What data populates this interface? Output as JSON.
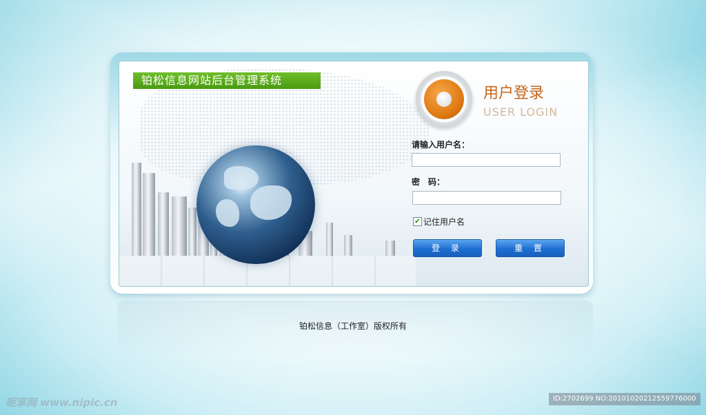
{
  "header": {
    "system_title": "铂松信息网站后台管理系统"
  },
  "login": {
    "title_cn": "用户登录",
    "title_en": "USER LOGIN",
    "username_label": "请输入用户名：",
    "username_value": "",
    "password_label": "密　码：",
    "password_value": "",
    "remember_label": "记住用户名",
    "remember_checked": true,
    "login_button": "登 录",
    "reset_button": "重 置"
  },
  "footer": {
    "copyright": "铂松信息（工作室）版权所有"
  },
  "watermark": {
    "left": "昵享网 www.nipic.cn",
    "right": "ID:2702699 NO:20101020212559776000"
  },
  "colors": {
    "title_bar": "#5aa81a",
    "accent_orange": "#e07b14",
    "button_blue": "#1f6fd1"
  }
}
